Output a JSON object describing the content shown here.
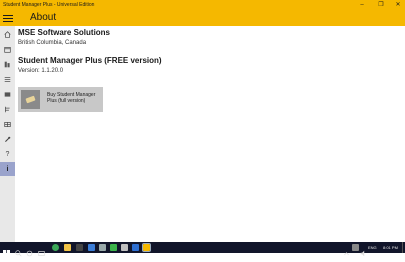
{
  "window": {
    "title": "Student Manager Plus - Universal Edition",
    "controls": [
      "minimize-icon",
      "restore-icon",
      "close-icon"
    ]
  },
  "header": {
    "menu_icon": "hamburger-icon",
    "title": "About"
  },
  "sidebar": {
    "items": [
      {
        "icon": "home-icon"
      },
      {
        "icon": "calendar-icon"
      },
      {
        "icon": "library-icon"
      },
      {
        "icon": "list-icon"
      },
      {
        "icon": "mail-icon"
      },
      {
        "icon": "document-icon"
      },
      {
        "icon": "grid-icon"
      },
      {
        "icon": "tools-icon"
      },
      {
        "icon": "help-icon"
      },
      {
        "icon": "info-icon",
        "active": true
      }
    ]
  },
  "about": {
    "company": "MSE Software Solutions",
    "location": "British Columbia, Canada",
    "product": "Student Manager Plus (FREE version)",
    "version": "Version: 1.1.20.0",
    "buy_button_label": "Buy Student Manager Plus (full version)"
  },
  "taskbar": {
    "icons": [
      "windows-start-icon",
      "search-icon",
      "cortana-icon",
      "task-view-icon",
      "chrome-icon",
      "explorer-icon",
      "store-icon",
      "mail-icon",
      "media-icon",
      "app-icon",
      "app-icon",
      "app-icon",
      "student-manager-icon"
    ],
    "language": "ENG",
    "time": "8:01 PM"
  },
  "colors": {
    "accent": "#f5b800",
    "sidebar_bg": "#e8e8e8",
    "sidebar_active": "#9aa3cc",
    "taskbar_bg": "#11152a",
    "button_bg": "#c8c8c8"
  }
}
